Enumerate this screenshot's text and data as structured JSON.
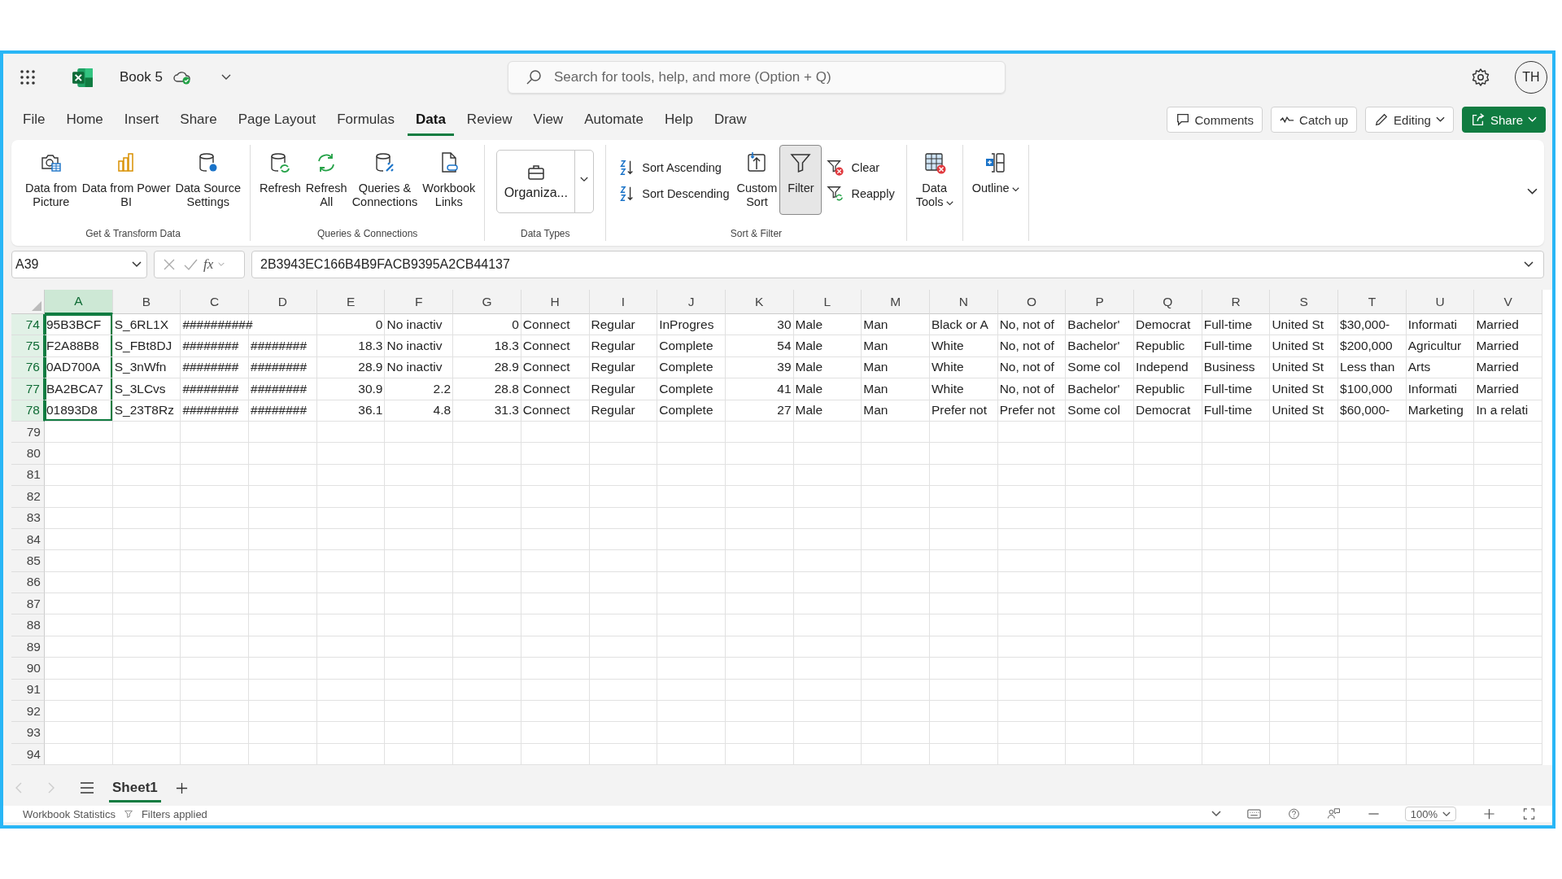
{
  "title_bar": {
    "doc_title": "Book 5",
    "search": {
      "placeholder": "Search for tools, help, and more (Option + Q)"
    },
    "avatar": "TH"
  },
  "menu_tabs": [
    {
      "label": "File",
      "selected": false
    },
    {
      "label": "Home",
      "selected": false
    },
    {
      "label": "Insert",
      "selected": false
    },
    {
      "label": "Share",
      "selected": false
    },
    {
      "label": "Page Layout",
      "selected": false
    },
    {
      "label": "Formulas",
      "selected": false
    },
    {
      "label": "Data",
      "selected": true
    },
    {
      "label": "Review",
      "selected": false
    },
    {
      "label": "View",
      "selected": false
    },
    {
      "label": "Automate",
      "selected": false
    },
    {
      "label": "Help",
      "selected": false
    },
    {
      "label": "Draw",
      "selected": false
    }
  ],
  "actions": [
    {
      "kind": "comments",
      "label": "Comments"
    },
    {
      "kind": "catchup",
      "label": "Catch up"
    },
    {
      "kind": "editing",
      "label": "Editing"
    },
    {
      "kind": "share",
      "label": "Share"
    }
  ],
  "ribbon": {
    "groups": [
      {
        "label": "Get & Transform Data",
        "items": [
          {
            "kind": "large",
            "label": "Data from\nPicture"
          },
          {
            "kind": "large",
            "label": "Data from Power\nBI"
          },
          {
            "kind": "large",
            "label": "Data Source\nSettings"
          }
        ]
      },
      {
        "label": "Queries & Connections",
        "items": [
          {
            "kind": "large",
            "label": "Refresh"
          },
          {
            "kind": "large",
            "label": "Refresh\nAll"
          },
          {
            "kind": "large",
            "label": "Queries &\nConnections"
          },
          {
            "kind": "large",
            "label": "Workbook\nLinks"
          }
        ]
      },
      {
        "label": "Data Types",
        "items": [
          {
            "kind": "gallery",
            "label": "Organiza..."
          }
        ]
      },
      {
        "label": "Sort & Filter",
        "items": [
          {
            "kind": "small",
            "label": "Sort Ascending"
          },
          {
            "kind": "small",
            "label": "Sort Descending"
          },
          {
            "kind": "large",
            "label": "Custom\nSort"
          },
          {
            "kind": "toggle",
            "label": "Filter",
            "on": true
          },
          {
            "kind": "small",
            "label": "Clear"
          },
          {
            "kind": "small",
            "label": "Reapply"
          }
        ]
      },
      {
        "items": [
          {
            "kind": "menu",
            "label": "Data\nTools"
          }
        ]
      },
      {
        "items": [
          {
            "kind": "menu",
            "label": "Outline"
          }
        ]
      }
    ]
  },
  "formula_bar": {
    "name_box": "A39",
    "function_label": "fx",
    "formula": "2B3943EC166B4B9FACB9395A2CB44137"
  },
  "columns": [
    {
      "label": "A",
      "selected": true
    },
    {
      "label": "B",
      "selected": false
    },
    {
      "label": "C",
      "selected": false
    },
    {
      "label": "D",
      "selected": false
    },
    {
      "label": "E",
      "selected": false
    },
    {
      "label": "F",
      "selected": false
    },
    {
      "label": "G",
      "selected": false
    },
    {
      "label": "H",
      "selected": false
    },
    {
      "label": "I",
      "selected": false
    },
    {
      "label": "J",
      "selected": false
    },
    {
      "label": "K",
      "selected": false
    },
    {
      "label": "L",
      "selected": false
    },
    {
      "label": "M",
      "selected": false
    },
    {
      "label": "N",
      "selected": false
    },
    {
      "label": "O",
      "selected": false
    },
    {
      "label": "P",
      "selected": false
    },
    {
      "label": "Q",
      "selected": false
    },
    {
      "label": "R",
      "selected": false
    },
    {
      "label": "S",
      "selected": false
    },
    {
      "label": "T",
      "selected": false
    },
    {
      "label": "U",
      "selected": false
    },
    {
      "label": "V",
      "selected": false
    }
  ],
  "rows": [
    {
      "number": "74",
      "selected": true,
      "cells": [
        "95B3BCF",
        "S_6RL1X",
        "##########",
        "",
        "0",
        "No inactiv",
        "0",
        "Connect",
        "Regular",
        "InProgres",
        "30",
        "Male",
        "Man",
        "Black or A",
        "No, not of",
        "Bachelor'",
        "Democrat",
        "Full-time",
        "United St",
        "$30,000-",
        "Informati",
        "Married"
      ]
    },
    {
      "number": "75",
      "selected": true,
      "cells": [
        "F2A88B8",
        "S_FBt8DJ",
        "########",
        "########",
        "18.3",
        "No inactiv",
        "18.3",
        "Connect",
        "Regular",
        "Complete",
        "54",
        "Male",
        "Man",
        "White",
        "No, not of",
        "Bachelor'",
        "Republic",
        "Full-time",
        "United St",
        "$200,000",
        "Agricultur",
        "Married"
      ]
    },
    {
      "number": "76",
      "selected": true,
      "cells": [
        "0AD700A",
        "S_3nWfn",
        "########",
        "########",
        "28.9",
        "No inactiv",
        "28.9",
        "Connect",
        "Regular",
        "Complete",
        "39",
        "Male",
        "Man",
        "White",
        "No, not of",
        "Some col",
        "Independ",
        "Business",
        "United St",
        "Less than",
        "Arts",
        "Married"
      ]
    },
    {
      "number": "77",
      "selected": true,
      "cells": [
        "BA2BCA7",
        "S_3LCvs",
        "########",
        "########",
        "30.9",
        "2.2",
        "28.8",
        "Connect",
        "Regular",
        "Complete",
        "41",
        "Male",
        "Man",
        "White",
        "No, not of",
        "Bachelor'",
        "Republic",
        "Full-time",
        "United St",
        "$100,000",
        "Informati",
        "Married"
      ]
    },
    {
      "number": "78",
      "selected": true,
      "cells": [
        "01893D8",
        "S_23T8Rz",
        "########",
        "########",
        "36.1",
        "4.8",
        "31.3",
        "Connect",
        "Regular",
        "Complete",
        "27",
        "Male",
        "Man",
        "Prefer not",
        "Prefer not",
        "Some col",
        "Democrat",
        "Full-time",
        "United St",
        "$60,000-",
        "Marketing",
        "In a relati"
      ]
    }
  ],
  "empty_rows": [
    "79",
    "80",
    "81",
    "82",
    "83",
    "84",
    "85",
    "86",
    "87",
    "88",
    "89",
    "90",
    "91",
    "92",
    "93",
    "94"
  ],
  "sheet_tabs": [
    {
      "label": "Sheet1",
      "selected": true
    }
  ],
  "status_bar": {
    "statistics": "Workbook Statistics",
    "filter_status": "Filters applied",
    "zoom": "100%"
  }
}
